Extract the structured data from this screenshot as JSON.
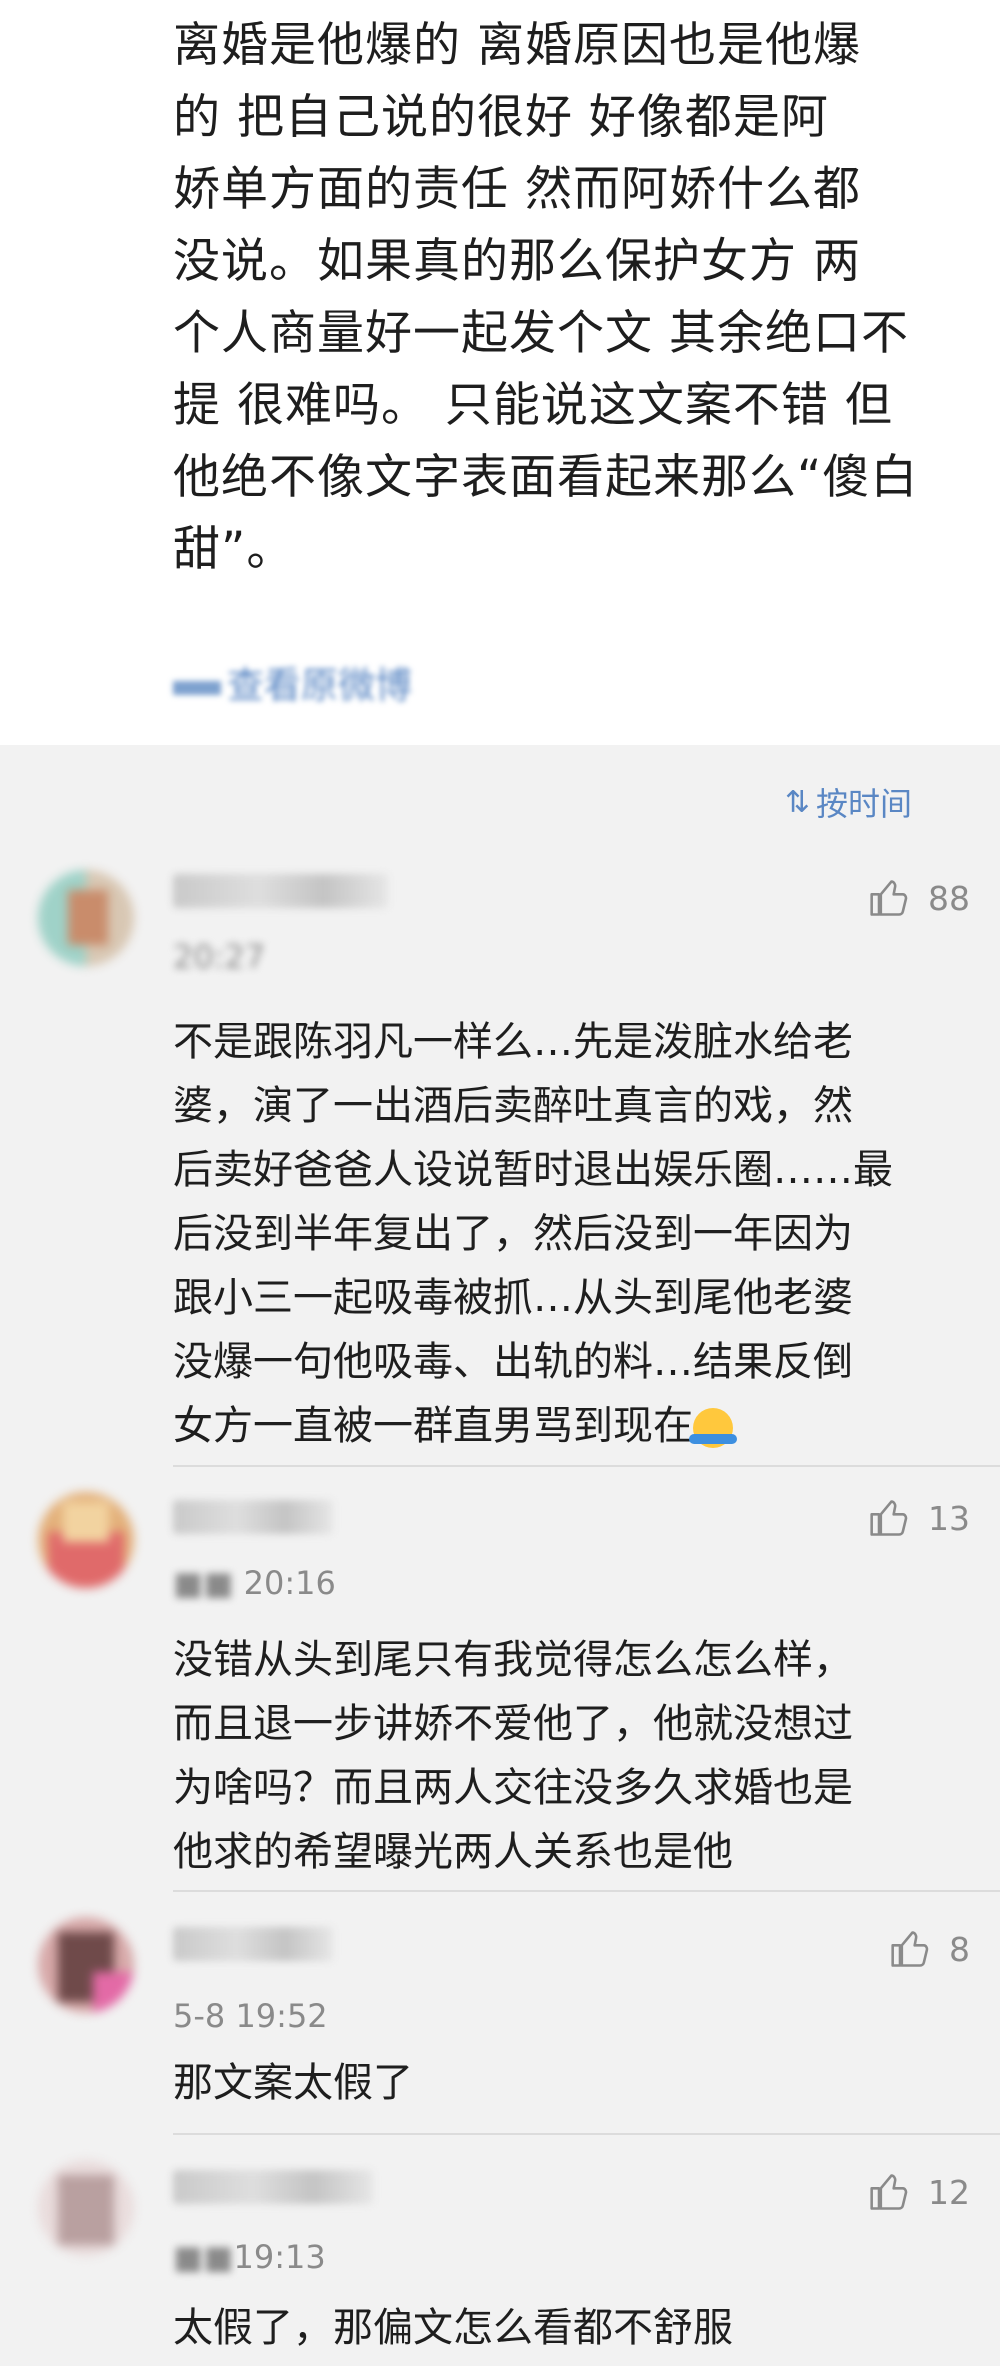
{
  "post": {
    "lines": [
      "离婚是他爆的   离婚原因也是他爆",
      "的   把自己说的很好   好像都是阿",
      "娇单方面的责任    然而阿娇什么都",
      "没说。如果真的那么保护女方  两",
      "个人商量好一起发个文  其余绝口不",
      "提 很难吗。 只能说这文案不错 但",
      "他绝不像文字表面看起来那么“傻白",
      "甜”。"
    ],
    "view_original": "查看原微博"
  },
  "sort": {
    "label": "按时间",
    "icon": "sort-time-icon"
  },
  "comments": [
    {
      "time": "20:27",
      "likes": "88",
      "lines": [
        "不是跟陈羽凡一样么…先是泼脏水给老",
        "婆，演了一出酒后卖醉吐真言的戏，然",
        "后卖好爸爸人设说暂时退出娱乐圈……最",
        "后没到半年复出了，然后没到一年因为",
        "跟小三一起吸毒被抓…从头到尾他老婆",
        "没爆一句他吸毒、出轨的料…结果反倒",
        "女方一直被一群直男骂到现在"
      ]
    },
    {
      "time": "20:16",
      "likes": "13",
      "lines": [
        "没错从头到尾只有我觉得怎么怎么样，",
        "而且退一步讲娇不爱他了，他就没想过",
        "为啥吗？而且两人交往没多久求婚也是",
        "他求的希望曝光两人关系也是他"
      ]
    },
    {
      "time": "5-8 19:52",
      "likes": "8",
      "lines": [
        "那文案太假了"
      ]
    },
    {
      "time": "19:13",
      "likes": "12",
      "lines": [
        "太假了，那偏文怎么看都不舒服"
      ]
    }
  ],
  "colors": {
    "accent": "#5a87c4",
    "meta": "#8a8a8a",
    "background": "#f2f2f2"
  },
  "icons": {
    "like": "thumbs-up-icon",
    "emoji": "shrug-emoji-icon"
  }
}
